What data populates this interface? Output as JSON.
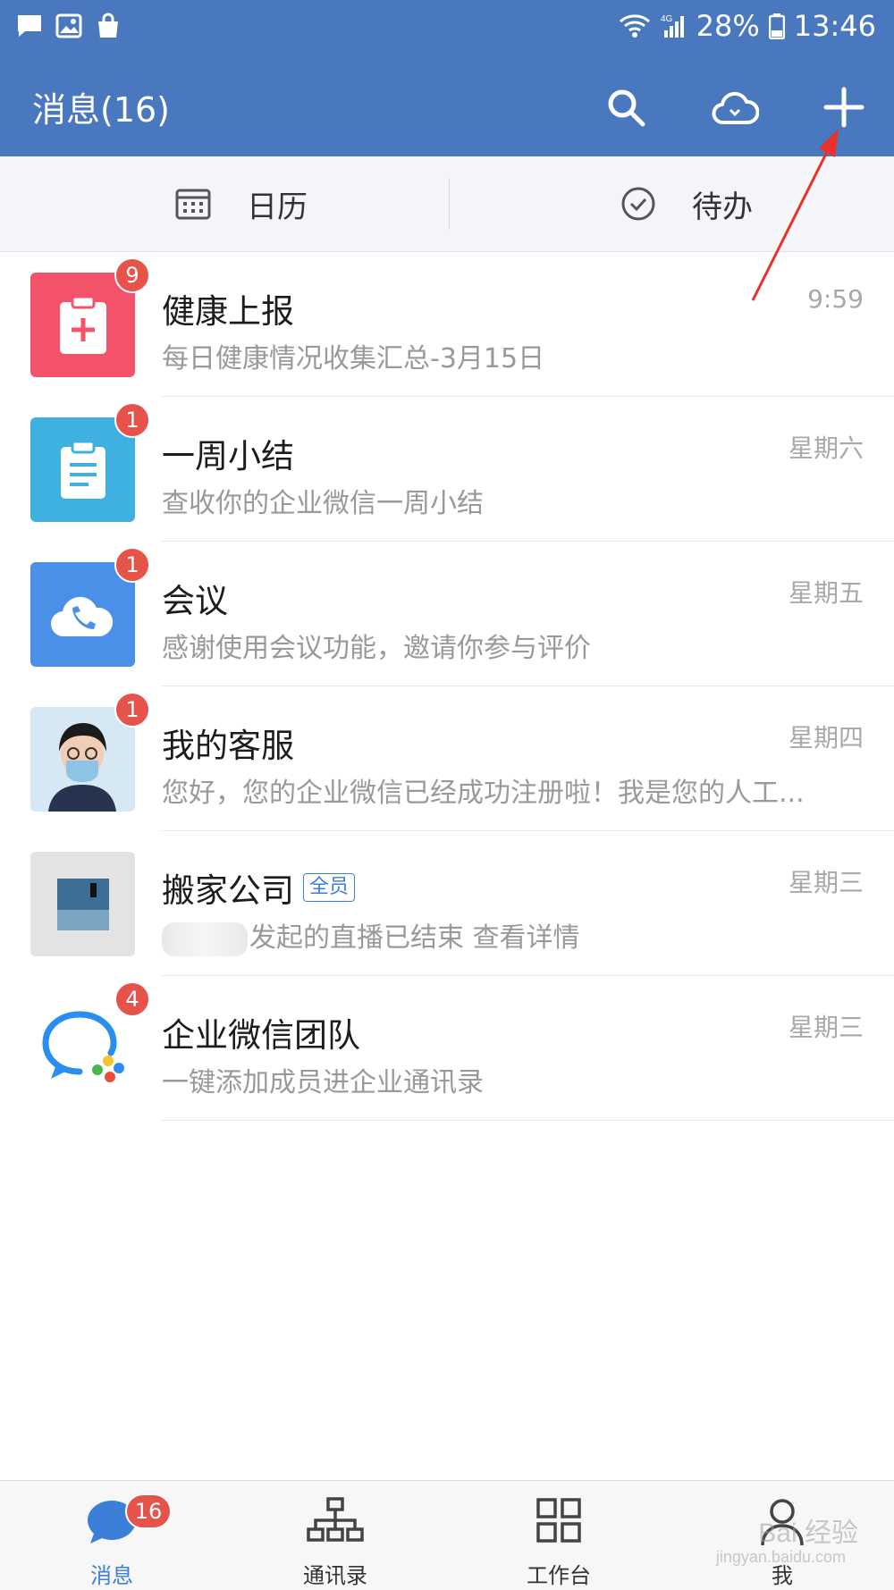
{
  "status_bar": {
    "battery": "28%",
    "time": "13:46",
    "network": "4G"
  },
  "header": {
    "title": "消息(16)"
  },
  "subbar": {
    "calendar_label": "日历",
    "todo_label": "待办"
  },
  "messages": [
    {
      "title": "健康上报",
      "subtitle": "每日健康情况收集汇总-3月15日",
      "time": "9:59",
      "badge": "9",
      "avatar_color": "#f2536a",
      "icon": "clipboard-plus-icon"
    },
    {
      "title": "一周小结",
      "subtitle": "查收你的企业微信一周小结",
      "time": "星期六",
      "badge": "1",
      "avatar_color": "#3eb1e0",
      "icon": "clipboard-list-icon"
    },
    {
      "title": "会议",
      "subtitle": "感谢使用会议功能，邀请你参与评价",
      "time": "星期五",
      "badge": "1",
      "avatar_color": "#4a90e8",
      "icon": "cloud-phone-icon"
    },
    {
      "title": "我的客服",
      "subtitle": "您好，您的企业微信已经成功注册啦！我是您的人工...",
      "time": "星期四",
      "badge": "1",
      "icon": "person-avatar"
    },
    {
      "title": "搬家公司",
      "tag": "全员",
      "subtitle": "发起的直播已结束 查看详情",
      "time": "星期三",
      "icon": "group-avatar"
    },
    {
      "title": "企业微信团队",
      "subtitle": "一键添加成员进企业通讯录",
      "time": "星期三",
      "badge": "4",
      "icon": "wecom-logo-icon"
    }
  ],
  "bottom_nav": {
    "messages_label": "消息",
    "messages_badge": "16",
    "contacts_label": "通讯录",
    "workbench_label": "工作台",
    "me_label": "我"
  },
  "watermark": {
    "line1": "Bai 经验",
    "line2": "jingyan.baidu.com"
  },
  "colors": {
    "header_bg": "#4a78be",
    "badge": "#e5534b",
    "accent": "#3c7fd8",
    "annotation_arrow": "#e8312a"
  }
}
